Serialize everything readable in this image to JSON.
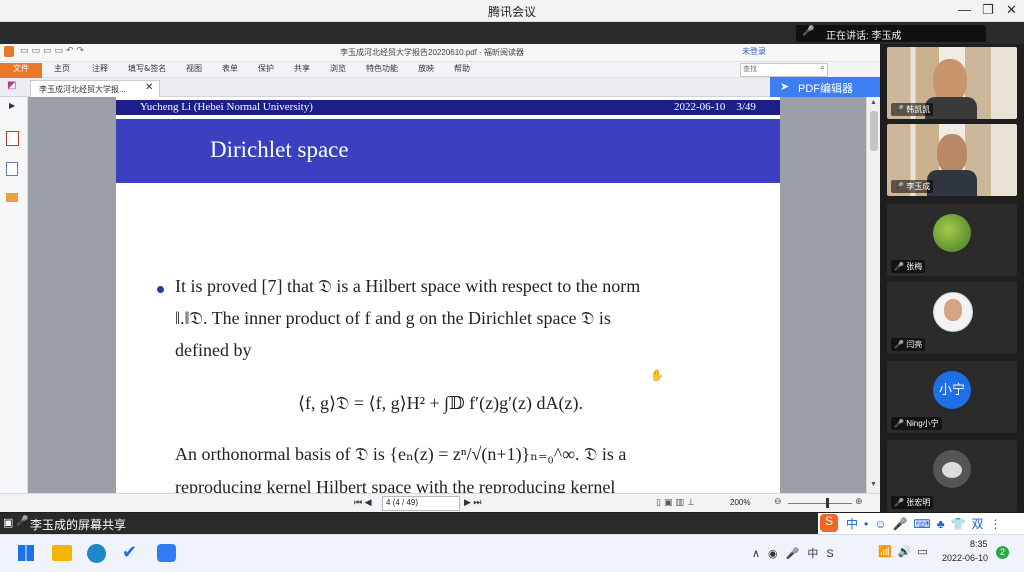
{
  "meeting": {
    "title": "腾讯会议",
    "speaking_label": "正在讲话: 李玉成"
  },
  "reader": {
    "window_title": "李玉成河北经贸大学报告20220610.pdf - 福昕阅读器",
    "login": "未登录",
    "menus": [
      "文件",
      "主页",
      "注释",
      "填写&签名",
      "视图",
      "表单",
      "保护",
      "共享",
      "浏览",
      "特色功能",
      "放映",
      "帮助"
    ],
    "search_placeholder": "查找",
    "tab_title": "李玉成河北经贸大学报...",
    "pdf_editor": "PDF编辑器",
    "page_field": "4 (4 / 49)",
    "zoom": "200%"
  },
  "slide": {
    "header_left": "Yucheng Li (Hebei Normal University)",
    "header_right": "2022-06-10    3/49",
    "frame_title": "Dirichlet space",
    "line1": "It is proved [7] that 𝔇 is a Hilbert space with respect to the norm",
    "line2": "‖.‖𝔇. The inner product of f and g on the Dirichlet space 𝔇 is",
    "line3": "defined by",
    "formula": "⟨f, g⟩𝔇 = ⟨f, g⟩H² + ∫𝔻 f′(z)g′(z) dA(z).",
    "line4": "An orthonormal basis of 𝔇 is {eₙ(z) = zⁿ/√(n+1)}ₙ₌₀^∞. 𝔇 is a",
    "line5": "reproducing kernel Hilbert space with the reproducing kernel"
  },
  "participants": [
    {
      "name": "韩凯凯",
      "type": "video"
    },
    {
      "name": "李玉成",
      "type": "video"
    },
    {
      "name": "张梅",
      "type": "avatar"
    },
    {
      "name": "闫亮",
      "type": "avatar"
    },
    {
      "name": "Ning小宁",
      "type": "initial",
      "initial": "小宁"
    },
    {
      "name": "张宏明",
      "type": "avatar"
    }
  ],
  "share_label": "李玉成的屏幕共享",
  "taskbar": {
    "time": "8:35",
    "date": "2022-06-10",
    "notif": "2"
  }
}
